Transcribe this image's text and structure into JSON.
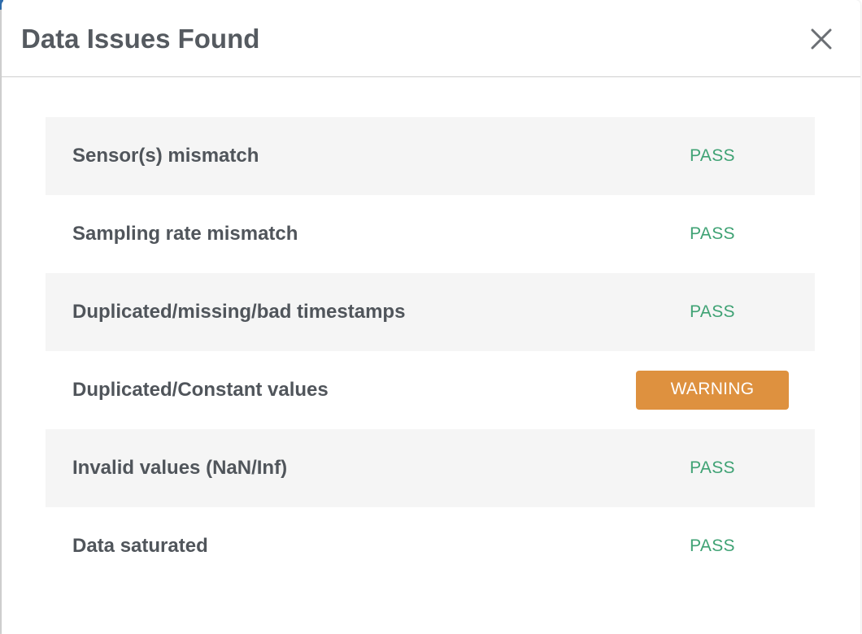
{
  "modal": {
    "title": "Data Issues Found",
    "close_icon": "close-icon"
  },
  "checks": [
    {
      "label": "Sensor(s) mismatch",
      "status": "PASS"
    },
    {
      "label": "Sampling rate mismatch",
      "status": "PASS"
    },
    {
      "label": "Duplicated/missing/bad timestamps",
      "status": "PASS"
    },
    {
      "label": "Duplicated/Constant values",
      "status": "WARNING"
    },
    {
      "label": "Invalid values (NaN/Inf)",
      "status": "PASS"
    },
    {
      "label": "Data saturated",
      "status": "PASS"
    }
  ],
  "colors": {
    "pass": "#3fa274",
    "warning": "#de913f",
    "title": "#555a60",
    "label": "#50555b",
    "row_shade": "#f5f5f5"
  }
}
